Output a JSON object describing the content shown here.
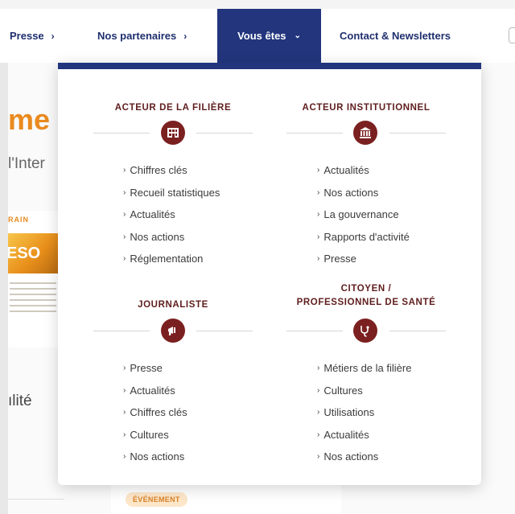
{
  "nav": {
    "items": [
      {
        "label": "Presse",
        "chevron": "›"
      },
      {
        "label": "Nos partenaires",
        "chevron": "›"
      },
      {
        "label": "Vous êtes",
        "chevron": "⌄"
      },
      {
        "label": "Contact & Newsletters"
      }
    ],
    "active_color": "#22357d"
  },
  "background": {
    "title_fragment": "me",
    "subtitle_fragment": "l'Inter",
    "image_top": "RAIN",
    "image_word": "ESO",
    "section_fragment": "ılité",
    "badge": "ÉVÉNEMENT"
  },
  "dropdown": {
    "accent_color": "#7b2020",
    "sections": [
      {
        "title": "ACTEUR DE LA FILIÈRE",
        "icon": "building-icon",
        "links": [
          "Chiffres clés",
          "Recueil statistiques",
          "Actualités",
          "Nos actions",
          "Réglementation"
        ]
      },
      {
        "title": "ACTEUR INSTITUTIONNEL",
        "icon": "institution-icon",
        "links": [
          "Actualités",
          "Nos actions",
          "La gouvernance",
          "Rapports d'activité",
          "Presse"
        ]
      },
      {
        "title": "JOURNALISTE",
        "icon": "megaphone-icon",
        "links": [
          "Presse",
          "Actualités",
          "Chiffres clés",
          "Cultures",
          "Nos actions"
        ]
      },
      {
        "title_line1": "CITOYEN /",
        "title_line2": "PROFESSIONNEL DE SANTÉ",
        "icon": "stethoscope-icon",
        "links": [
          "Métiers de la filière",
          "Cultures",
          "Utilisations",
          "Actualités",
          "Nos actions"
        ]
      }
    ]
  }
}
